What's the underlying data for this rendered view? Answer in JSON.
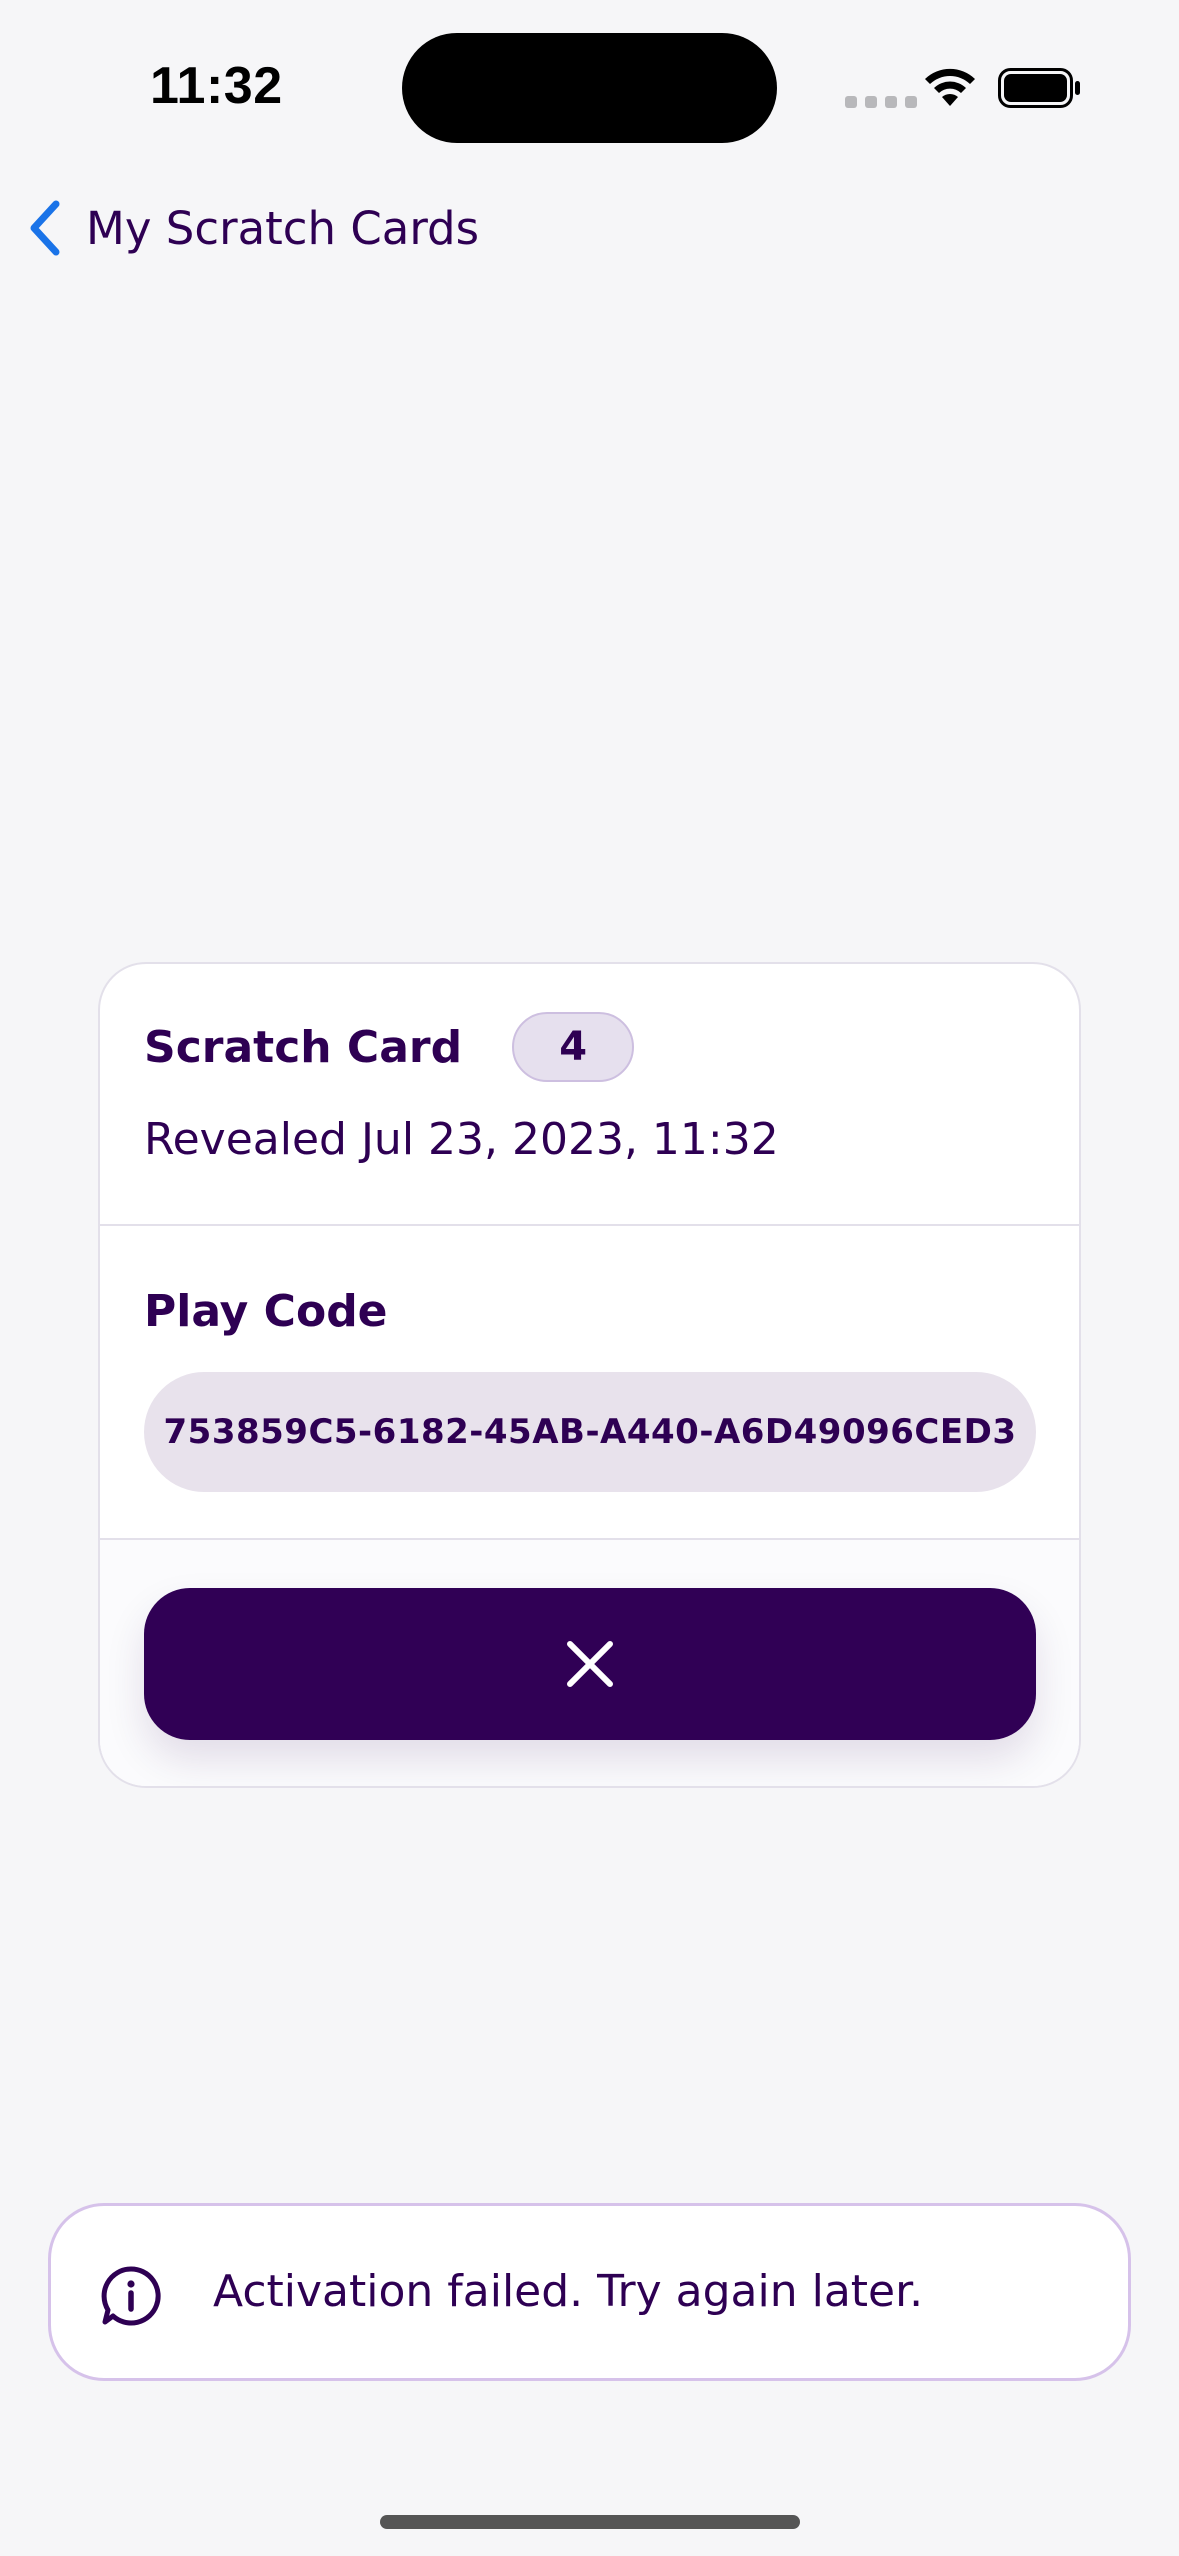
{
  "status_bar": {
    "time": "11:32",
    "wifi_icon": "wifi-icon",
    "battery_icon": "battery-icon"
  },
  "nav": {
    "back_label": "My Scratch Cards",
    "back_icon": "chevron-left-icon",
    "accent": "#1a73e8"
  },
  "card": {
    "title": "Scratch Card",
    "badge": "4",
    "revealed": "Revealed Jul 23, 2023, 11:32",
    "play_code_label": "Play Code",
    "play_code": "753859C5-6182-45AB-A440-A6D49096CED3",
    "close_icon": "close-icon",
    "button_color": "#300055"
  },
  "toast": {
    "icon": "info-bubble-icon",
    "message": "Activation failed. Try again later."
  }
}
